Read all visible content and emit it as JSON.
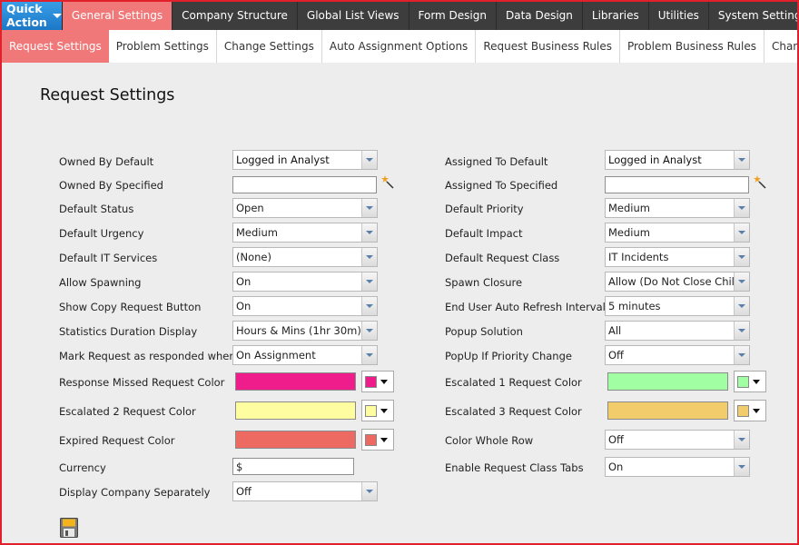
{
  "topnav": {
    "quick_action": "Quick Action",
    "items": [
      "General Settings",
      "Company Structure",
      "Global List Views",
      "Form Design",
      "Data Design",
      "Libraries",
      "Utilities",
      "System Settings"
    ]
  },
  "subnav": {
    "items": [
      "Request Settings",
      "Problem Settings",
      "Change Settings",
      "Auto Assignment Options",
      "Request Business Rules",
      "Problem Business Rules",
      "Change Busines"
    ]
  },
  "title": "Request Settings",
  "left": {
    "owned_by_default": {
      "label": "Owned By Default",
      "value": "Logged in Analyst"
    },
    "owned_by_specified": {
      "label": "Owned By Specified",
      "value": ""
    },
    "default_status": {
      "label": "Default Status",
      "value": "Open"
    },
    "default_urgency": {
      "label": "Default Urgency",
      "value": "Medium"
    },
    "default_it_services": {
      "label": "Default IT Services",
      "value": "(None)"
    },
    "allow_spawning": {
      "label": "Allow Spawning",
      "value": "On"
    },
    "show_copy_request_button": {
      "label": "Show Copy Request Button",
      "value": "On"
    },
    "statistics_duration_display": {
      "label": "Statistics Duration Display",
      "value": "Hours & Mins (1hr 30m)"
    },
    "mark_request_responded": {
      "label": "Mark Request as responded when",
      "value": "On Assignment"
    },
    "response_missed_color": {
      "label": "Response Missed Request Color",
      "color": "#ef1d8c"
    },
    "escalated2_color": {
      "label": "Escalated 2 Request Color",
      "color": "#fefea0"
    },
    "expired_color": {
      "label": "Expired Request Color",
      "color": "#ec6a62"
    },
    "currency": {
      "label": "Currency",
      "value": "$"
    },
    "display_company_separately": {
      "label": "Display Company Separately",
      "value": "Off"
    }
  },
  "right": {
    "assigned_to_default": {
      "label": "Assigned To Default",
      "value": "Logged in Analyst"
    },
    "assigned_to_specified": {
      "label": "Assigned To Specified",
      "value": ""
    },
    "default_priority": {
      "label": "Default Priority",
      "value": "Medium"
    },
    "default_impact": {
      "label": "Default Impact",
      "value": "Medium"
    },
    "default_request_class": {
      "label": "Default Request Class",
      "value": "IT Incidents"
    },
    "spawn_closure": {
      "label": "Spawn Closure",
      "value": "Allow (Do Not Close Child"
    },
    "end_user_auto_refresh": {
      "label": "End User Auto Refresh Interval",
      "value": "5 minutes"
    },
    "popup_solution": {
      "label": "Popup Solution",
      "value": "All"
    },
    "popup_if_priority_change": {
      "label": "PopUp If Priority Change",
      "value": "Off"
    },
    "escalated1_color": {
      "label": "Escalated 1 Request Color",
      "color": "#a2fea2"
    },
    "escalated3_color": {
      "label": "Escalated 3 Request Color",
      "color": "#f2cc6a"
    },
    "color_whole_row": {
      "label": "Color Whole Row",
      "value": "Off"
    },
    "enable_request_class_tabs": {
      "label": "Enable Request Class Tabs",
      "value": "On"
    }
  },
  "icons": {
    "wand": "magic-wand-icon",
    "save": "save-icon",
    "dropdown": "chevron-down-icon"
  }
}
